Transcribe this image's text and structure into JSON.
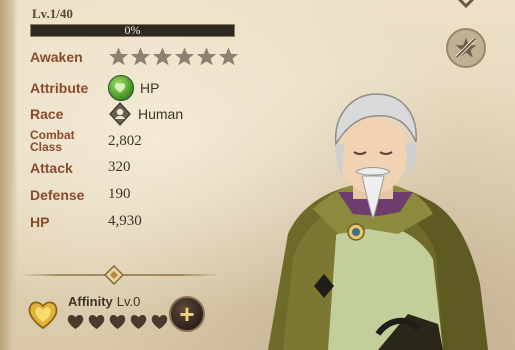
{
  "hero": {
    "level": "Lv.1/40",
    "xp_percent": 0,
    "xp_text": "0%"
  },
  "stats": {
    "awaken_label": "Awaken",
    "awaken_stars_filled": 0,
    "awaken_stars_total": 6,
    "attribute_label": "Attribute",
    "attribute_value": "HP",
    "race_label": "Race",
    "race_value": "Human",
    "combat_class_label_line1": "Combat",
    "combat_class_label_line2": "Class",
    "combat_class_value": "2,802",
    "attack_label": "Attack",
    "attack_value": "320",
    "defense_label": "Defense",
    "defense_value": "190",
    "hp_label": "HP",
    "hp_value": "4,930"
  },
  "affinity": {
    "label": "Affinity",
    "level": "Lv.0",
    "hearts_filled": 0,
    "hearts_total": 5
  },
  "icons": {
    "attribute": "hp-attribute-icon",
    "race": "human-race-icon",
    "corner_button": "star-slash-icon",
    "add_button": "plus-icon",
    "top_arrow": "chevron-down-icon"
  },
  "colors": {
    "label": "#8a4b2b",
    "value": "#3e3426",
    "xp_fill": "#9ad14c",
    "star_empty": "#8c8273",
    "heart_empty": "#4a3a2c"
  }
}
